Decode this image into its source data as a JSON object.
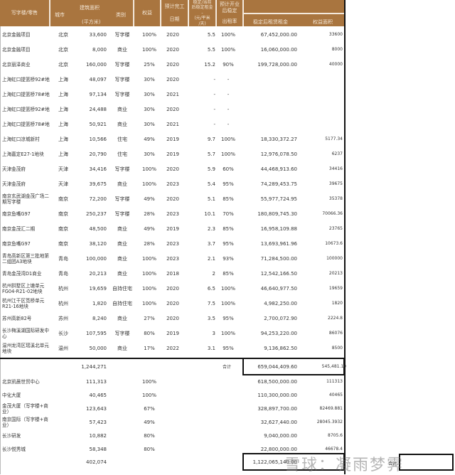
{
  "headers": {
    "name": "写字楼/零售",
    "city": "城市",
    "area": "建筑面积",
    "area_unit": "(平方米)",
    "type": "类别",
    "equity": "权益",
    "completion_a": "预计完工",
    "completion_b": "日期",
    "rent_a": "稳定/当前",
    "rent_b": "后稳定租金",
    "rent_c": "(元/平米",
    "rent_d": "/天)",
    "occ_a": "预计开业",
    "occ_b": "后稳定",
    "occ_c": "出租率",
    "income": "稳定后租赁租金",
    "equity_area": "权益面积"
  },
  "rows": [
    {
      "name": "北京金融项目",
      "city": "北京",
      "area": "33,600",
      "type": "写字楼",
      "equity": "100%",
      "year": "2020",
      "rent": "5.5",
      "occ": "100%",
      "income": "67,452,000.00",
      "equity_area": "33600"
    },
    {
      "name": "北京金融项目",
      "city": "北京",
      "area": "8,000",
      "type": "商业",
      "equity": "100%",
      "year": "2020",
      "rent": "5.5",
      "occ": "100%",
      "income": "16,060,000.00",
      "equity_area": "8000"
    },
    {
      "name": "北京丽泽商业",
      "city": "北京",
      "area": "160,000",
      "type": "写字楼",
      "equity": "25%",
      "year": "2020",
      "rent": "15.2",
      "occ": "90%",
      "income": "199,728,000.00",
      "equity_area": "40000"
    },
    {
      "name": "上海虹口提篮桥92#地",
      "city": "上海",
      "area": "48,097",
      "type": "写字楼",
      "equity": "30%",
      "year": "2020",
      "rent": "-",
      "occ": "-",
      "income": "",
      "equity_area": ""
    },
    {
      "name": "上海虹口提篮桥78#地",
      "city": "上海",
      "area": "97,134",
      "type": "写字楼",
      "equity": "30%",
      "year": "2021",
      "rent": "-",
      "occ": "-",
      "income": "",
      "equity_area": ""
    },
    {
      "name": "上海虹口提篮桥92#地",
      "city": "上海",
      "area": "24,488",
      "type": "商业",
      "equity": "30%",
      "year": "2020",
      "rent": "-",
      "occ": "-",
      "income": "",
      "equity_area": ""
    },
    {
      "name": "上海虹口提篮桥78#地",
      "city": "上海",
      "area": "50,921",
      "type": "商业",
      "equity": "30%",
      "year": "2021",
      "rent": "-",
      "occ": "-",
      "income": "",
      "equity_area": ""
    },
    {
      "name": "上海虹口凉城新村",
      "city": "上海",
      "area": "10,566",
      "type": "住宅",
      "equity": "49%",
      "year": "2019",
      "rent": "9.7",
      "occ": "100%",
      "income": "18,330,372.27",
      "equity_area": "5177.34"
    },
    {
      "name": "上海嘉定E27-1地块",
      "city": "上海",
      "area": "20,790",
      "type": "住宅",
      "equity": "30%",
      "year": "2019",
      "rent": "5.7",
      "occ": "100%",
      "income": "12,976,078.50",
      "equity_area": "6237"
    },
    {
      "name": "天津金茂府",
      "city": "天津",
      "area": "34,416",
      "type": "写字楼",
      "equity": "100%",
      "year": "2020",
      "rent": "5.9",
      "occ": "60%",
      "income": "44,468,913.60",
      "equity_area": "34416"
    },
    {
      "name": "天津金茂府",
      "city": "天津",
      "area": "39,675",
      "type": "商业",
      "equity": "100%",
      "year": "2023",
      "rent": "5.4",
      "occ": "95%",
      "income": "74,289,453.75",
      "equity_area": "39675"
    },
    {
      "name": "南京玄武湖金茂广场二期写字楼",
      "city": "南京",
      "area": "72,200",
      "type": "写字楼",
      "equity": "49%",
      "year": "2020",
      "rent": "5.1",
      "occ": "85%",
      "income": "55,977,724.95",
      "equity_area": "35378"
    },
    {
      "name": "南京鱼嘴G97",
      "city": "南京",
      "area": "250,237",
      "type": "写字楼",
      "equity": "28%",
      "year": "2023",
      "rent": "10.1",
      "occ": "70%",
      "income": "180,809,745.30",
      "equity_area": "70066.36"
    },
    {
      "name": "南京金茂汇二期",
      "city": "南京",
      "area": "48,500",
      "type": "商业",
      "equity": "49%",
      "year": "2019",
      "rent": "2.3",
      "occ": "85%",
      "income": "16,958,109.88",
      "equity_area": "23765"
    },
    {
      "name": "南京鱼嘴G97",
      "city": "南京",
      "area": "38,120",
      "type": "商业",
      "equity": "28%",
      "year": "2023",
      "rent": "3.7",
      "occ": "95%",
      "income": "13,693,961.96",
      "equity_area": "10673.6"
    },
    {
      "name": "青岛高新区第三批地第二组团A3地块",
      "city": "青岛",
      "area": "100,000",
      "type": "商业",
      "equity": "100%",
      "year": "2023",
      "rent": "2.1",
      "occ": "93%",
      "income": "71,284,500.00",
      "equity_area": "100000"
    },
    {
      "name": "青岛金茂湾D1商业",
      "city": "青岛",
      "area": "20,213",
      "type": "商业",
      "equity": "100%",
      "year": "2018",
      "rent": "2",
      "occ": "85%",
      "income": "12,542,166.50",
      "equity_area": "20213"
    },
    {
      "name": "杭州拱墅区上塘单元FG04-R21-02地块",
      "city": "杭州",
      "area": "19,659",
      "type": "自持住宅",
      "equity": "100%",
      "year": "2020",
      "rent": "6.5",
      "occ": "100%",
      "income": "46,640,977.50",
      "equity_area": "19659"
    },
    {
      "name": "杭州江干区笕桥单元R21-16地块",
      "city": "杭州",
      "area": "1,820",
      "type": "自持住宅",
      "equity": "100%",
      "year": "2020",
      "rent": "7.5",
      "occ": "100%",
      "income": "4,982,250.00",
      "equity_area": "1820"
    },
    {
      "name": "苏州高新82号",
      "city": "苏州",
      "area": "8,240",
      "type": "商业",
      "equity": "27%",
      "year": "2020",
      "rent": "3.5",
      "occ": "95%",
      "income": "2,700,072.90",
      "equity_area": "2224.8"
    },
    {
      "name": "长沙梅溪湖国际研发中心",
      "city": "长沙",
      "area": "107,595",
      "type": "写字楼",
      "equity": "80%",
      "year": "2019",
      "rent": "3",
      "occ": "100%",
      "income": "94,253,220.00",
      "equity_area": "86076"
    },
    {
      "name": "温州龙湾区瑶溪北单元地块",
      "city": "温州",
      "area": "50,000",
      "type": "商业",
      "equity": "17%",
      "year": "2022",
      "rent": "3.1",
      "occ": "95%",
      "income": "9,136,862.50",
      "equity_area": "8500"
    }
  ],
  "subtotal1": {
    "area": "1,244,271",
    "label": "合计",
    "income": "659,044,409.60",
    "equity_area": "545,481.10"
  },
  "rows2": [
    {
      "name": "北京凯晨世贸中心",
      "area": "111,313",
      "equity": "100%",
      "income": "618,500,000.00",
      "equity_area": "111313"
    },
    {
      "name": "中化大厦",
      "area": "40,465",
      "equity": "100%",
      "income": "110,300,000.00",
      "equity_area": "40465"
    },
    {
      "name": "金茂大厦（写字楼+商业）",
      "area": "123,643",
      "equity": "67%",
      "income": "328,897,700.00",
      "equity_area": "82469.881"
    },
    {
      "name": "南京国际（写字楼+商业）",
      "area": "57,423",
      "equity": "49%",
      "income": "32,627,440.00",
      "equity_area": "28045.3932"
    },
    {
      "name": "长沙研发",
      "area": "10,882",
      "equity": "80%",
      "income": "9,040,000.00",
      "equity_area": "8705.6"
    },
    {
      "name": "长沙悦秀城",
      "area": "58,348",
      "equity": "80%",
      "income": "22,800,000.00",
      "equity_area": "46678.4"
    }
  ],
  "subtotal2": {
    "area": "402,074",
    "income": "1,122,065,140.00"
  },
  "grand_total": {
    "label": "合计",
    "value": "…,1??,?50"
  },
  "watermark": "雪球：凝雨梦霁"
}
